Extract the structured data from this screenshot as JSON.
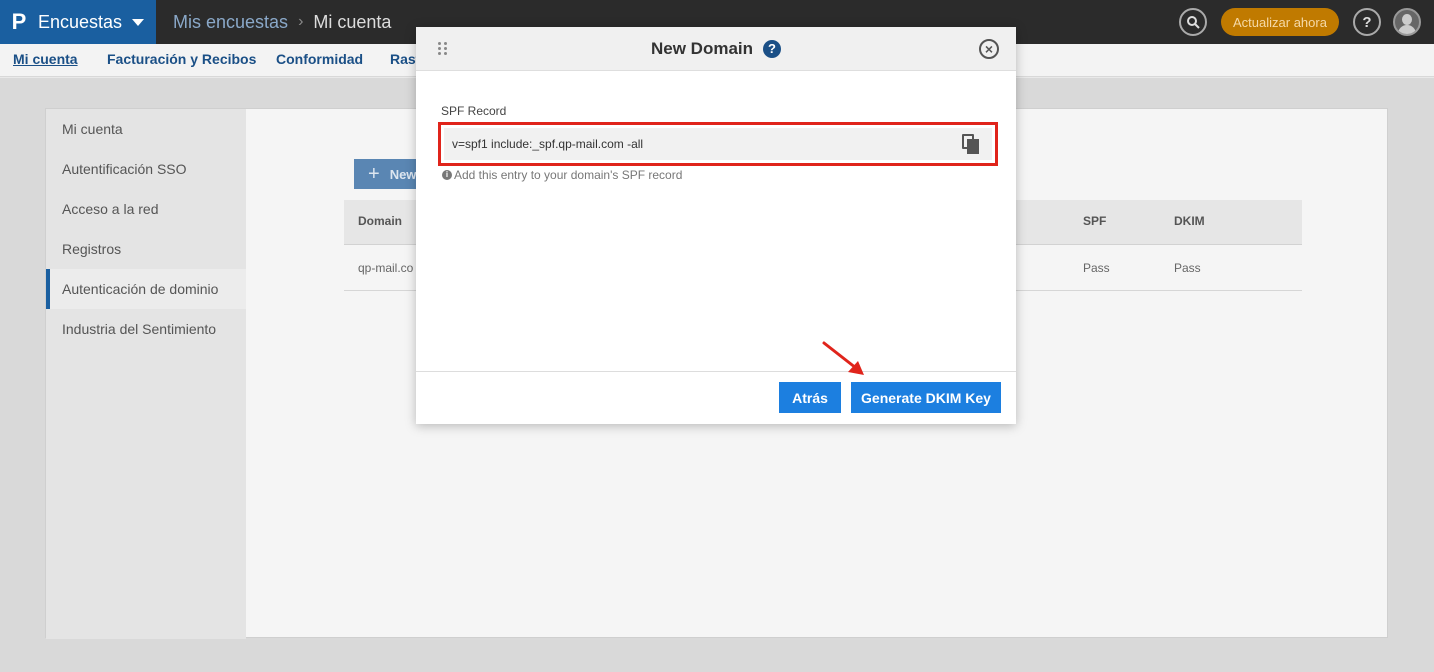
{
  "topbar": {
    "logo": "P",
    "app_name": "Encuestas",
    "breadcrumb": [
      "Mis encuestas",
      "Mi cuenta"
    ],
    "breadcrumb_sep": "›",
    "search_icon": "search-icon",
    "upgrade_label": "Actualizar ahora",
    "help_label": "?",
    "accent": "#1a5fa0",
    "upgrade_color": "#c07a00"
  },
  "subnav": {
    "items": [
      "Mi cuenta",
      "Facturación y Recibos",
      "Conformidad",
      "Rast"
    ]
  },
  "sidebar": {
    "items": [
      {
        "label": "Mi cuenta"
      },
      {
        "label": "Autentificación SSO"
      },
      {
        "label": "Acceso a la red"
      },
      {
        "label": "Registros"
      },
      {
        "label": "Autenticación de dominio",
        "active": true
      },
      {
        "label": "Industria del Sentimiento"
      }
    ]
  },
  "main": {
    "new_button": "New",
    "columns": [
      "Domain",
      "SPF",
      "DKIM"
    ],
    "rows": [
      {
        "domain": "qp-mail.co",
        "spf": "Pass",
        "dkim": "Pass"
      }
    ]
  },
  "modal": {
    "title": "New Domain",
    "help_label": "?",
    "close_label": "×",
    "spf_label": "SPF Record",
    "spf_value": "v=spf1 include:_spf.qp-mail.com -all",
    "hint_icon": "i",
    "hint": "Add this entry to your domain's SPF record",
    "back_button": "Atrás",
    "generate_button": "Generate DKIM Key",
    "button_color": "#1c7fe0",
    "highlight_color": "#e0241b"
  }
}
